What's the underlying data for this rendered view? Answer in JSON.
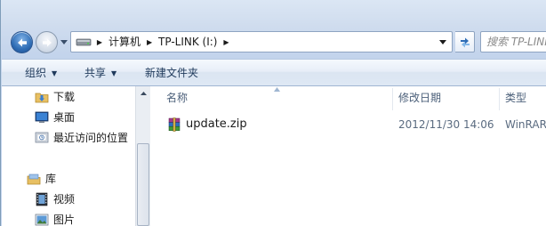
{
  "address_bar": {
    "breadcrumbs": [
      "计算机",
      "TP-LINK (I:)"
    ]
  },
  "search": {
    "placeholder": "搜索 TP-LINK"
  },
  "toolbar": {
    "organize_label": "组织",
    "share_label": "共享",
    "new_folder_label": "新建文件夹"
  },
  "nav_pane": {
    "items": [
      {
        "label": "下载",
        "icon": "downloads-folder-icon"
      },
      {
        "label": "桌面",
        "icon": "desktop-icon"
      },
      {
        "label": "最近访问的位置",
        "icon": "recent-places-icon"
      },
      {
        "label": "库",
        "icon": "libraries-icon"
      },
      {
        "label": "视频",
        "icon": "videos-icon"
      },
      {
        "label": "图片",
        "icon": "pictures-icon"
      }
    ]
  },
  "file_list": {
    "columns": [
      "名称",
      "修改日期",
      "类型"
    ],
    "files": [
      {
        "name": "update.zip",
        "modified": "2012/11/30 14:06",
        "type": "WinRAR",
        "icon": "winrar-archive-icon"
      }
    ]
  }
}
